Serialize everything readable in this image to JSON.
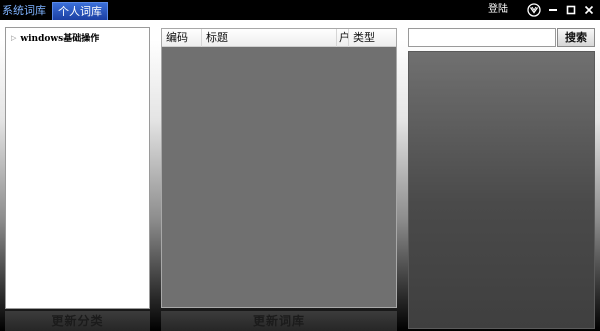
{
  "titlebar": {
    "tabs": [
      {
        "label": "系统词库"
      },
      {
        "label": "个人词库"
      }
    ],
    "login_label": "登陆"
  },
  "left_panel": {
    "tree_items": [
      {
        "label": "windows基础操作"
      }
    ],
    "update_button_label": "更新分类"
  },
  "middle_panel": {
    "columns": [
      {
        "label": "编码"
      },
      {
        "label": "标题"
      },
      {
        "label": "户"
      },
      {
        "label": "类型"
      }
    ],
    "update_button_label": "更新词库"
  },
  "search": {
    "value": "",
    "button_label": "搜索"
  },
  "colors": {
    "tab_active_bg": "#2b57c4",
    "tab_inactive_text": "#7fb3ff",
    "titlebar_bg": "#000000"
  },
  "icons": [
    "tree-expand-arrow-icon",
    "app-logo-icon",
    "minimize-icon",
    "maximize-icon",
    "close-icon"
  ]
}
